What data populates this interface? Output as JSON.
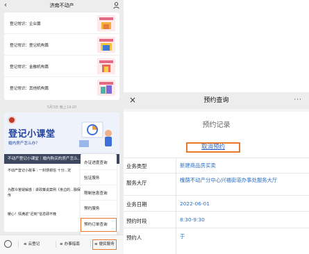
{
  "left": {
    "header": {
      "title": "济南不动产",
      "back_icon": "chevron-left-icon",
      "profile_icon": "person-icon"
    },
    "articles": [
      {
        "title": "登记常识：企业篇",
        "thumb": "企业篇"
      },
      {
        "title": "登记常识：登记机构篇",
        "thumb": "登记机构篇"
      },
      {
        "title": "登记常识：金融机构篇",
        "thumb": "金融机构篇"
      },
      {
        "title": "登记常识：其他机构篇",
        "thumb": "其他机构篇"
      }
    ],
    "timestamp": "5月3日 晚上19:20",
    "promo": {
      "banner_title": "登记小课堂",
      "banner_sub": "婚内房产怎么办？",
      "headline": "不动产登记小课堂｜婚内购买的房产怎么...",
      "items": [
        "不动产登记小故事｜一封感谢信 十分...定",
        "为群众答疑解惑｜讲政策说案例《身边的...融保宣传",
        "暖心！情满返“迟到”信息即不晚"
      ]
    },
    "menu": [
      "办证进度查询",
      "验证服务",
      "限制信息查询",
      "预约服务",
      "预约订单查询"
    ],
    "tabbar": [
      "云登记",
      "办事指南",
      "便民服务"
    ]
  },
  "right": {
    "nav": {
      "title": "预约查询",
      "close": "×",
      "more": "···"
    },
    "record_title": "预约记录",
    "cancel_label": "取消预约",
    "rows": [
      {
        "label": "业务类型",
        "value": "新建商品房买卖"
      },
      {
        "label": "服务大厅",
        "value": "槐荫不动产分中心兴福街道办事处服务大厅"
      },
      {
        "label": "业务日期",
        "value": "2022-06-01"
      },
      {
        "label": "预约时段",
        "value": "8:30-9:30"
      },
      {
        "label": "预约人",
        "value": "于"
      }
    ]
  },
  "colors": {
    "highlight": "#e8782b",
    "link": "#2d63c8",
    "value": "#2a6fc4",
    "banner_text": "#1d3f9e"
  }
}
